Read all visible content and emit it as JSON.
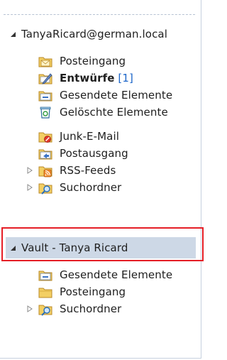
{
  "accounts": [
    {
      "name": "TanyaRicard@german.local",
      "expanded": true,
      "folders": [
        {
          "label": "Posteingang",
          "icon": "inbox-icon"
        },
        {
          "label": "Entwürfe",
          "count": "[1]",
          "bold": true,
          "icon": "drafts-icon"
        },
        {
          "label": "Gesendete Elemente",
          "icon": "sent-items-icon"
        },
        {
          "label": "Gelöschte Elemente",
          "icon": "deleted-items-icon"
        },
        {
          "label": "Junk-E-Mail",
          "icon": "junk-mail-icon"
        },
        {
          "label": "Postausgang",
          "icon": "outbox-icon"
        },
        {
          "label": "RSS-Feeds",
          "icon": "rss-feeds-icon",
          "collapsed": true
        },
        {
          "label": "Suchordner",
          "icon": "search-folder-icon",
          "collapsed": true
        }
      ]
    },
    {
      "name": "Vault - Tanya Ricard",
      "expanded": true,
      "selected": true,
      "folders": [
        {
          "label": "Gesendete Elemente",
          "icon": "sent-items-icon"
        },
        {
          "label": "Posteingang",
          "icon": "folder-icon"
        },
        {
          "label": "Suchordner",
          "icon": "search-folder-icon",
          "collapsed": true
        }
      ]
    }
  ],
  "colors": {
    "selection_bg": "#cdd8e6",
    "highlight_border": "#e51e26",
    "unread_count": "#1d66c9"
  }
}
